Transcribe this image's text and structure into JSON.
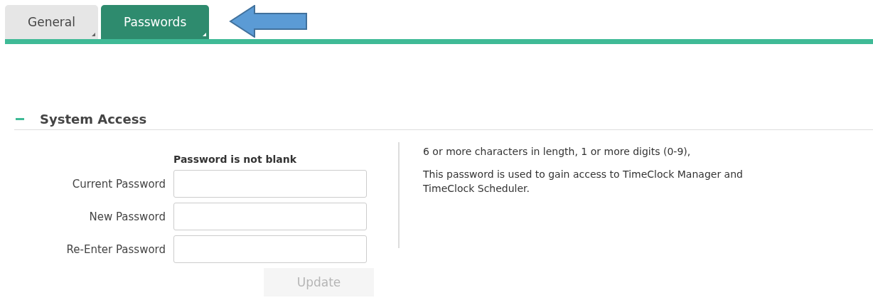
{
  "tabs": [
    {
      "label": "General",
      "selected": false
    },
    {
      "label": "Passwords",
      "selected": true
    }
  ],
  "section": {
    "title": "System Access",
    "expanded": true,
    "form_heading": "Password is not blank",
    "fields": [
      {
        "label": "Current Password"
      },
      {
        "label": "New Password"
      },
      {
        "label": "Re-Enter Password"
      }
    ],
    "update_button": {
      "label": "Update",
      "disabled": true
    },
    "help": [
      "6 or more characters in length, 1 or more digits (0-9),",
      "This password is used to gain access to TimeClock Manager and TimeClock Scheduler."
    ]
  }
}
